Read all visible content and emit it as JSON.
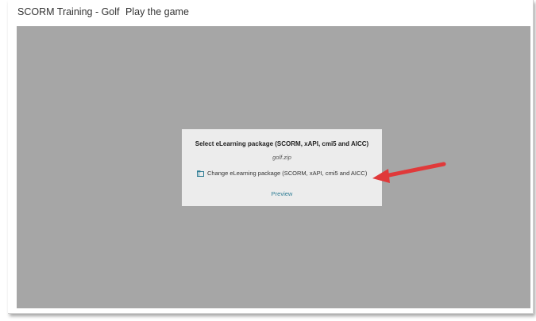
{
  "window": {
    "title_part1": "SCORM Training - Golf",
    "title_part2": "Play the game"
  },
  "dialog": {
    "title": "Select eLearning package (SCORM, xAPI, cmi5 and AICC)",
    "filename": "golf.zip",
    "change_label": "Change eLearning package (SCORM, xAPI, cmi5 and AICC)",
    "change_icon": "folder-icon",
    "preview_label": "Preview"
  },
  "colors": {
    "canvas_bg": "#a6a6a6",
    "dialog_bg": "#ececec",
    "link_color": "#2f7d95",
    "arrow_color": "#e0393a"
  }
}
